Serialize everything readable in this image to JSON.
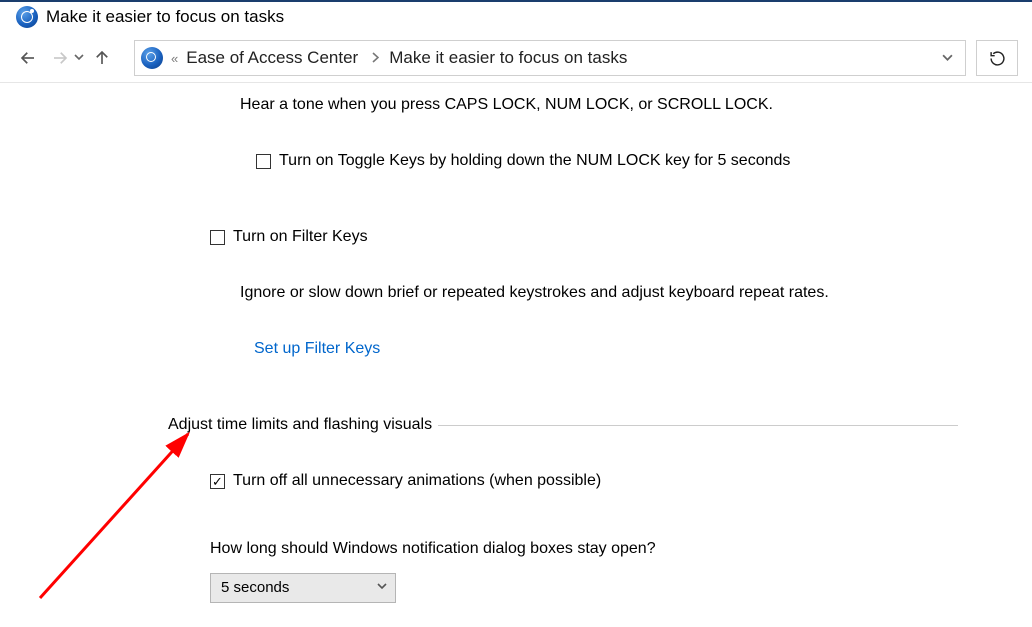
{
  "window": {
    "title": "Make it easier to focus on tasks"
  },
  "breadcrumb": {
    "item1": "Ease of Access Center",
    "item2": "Make it easier to focus on tasks"
  },
  "toggleKeys": {
    "desc": "Hear a tone when you press CAPS LOCK, NUM LOCK, or SCROLL LOCK.",
    "holdLabel": "Turn on Toggle Keys by holding down the NUM LOCK key for 5 seconds"
  },
  "filterKeys": {
    "toggleLabel": "Turn on Filter Keys",
    "desc": "Ignore or slow down brief or repeated keystrokes and adjust keyboard repeat rates.",
    "link": "Set up Filter Keys"
  },
  "timeLimits": {
    "header": "Adjust time limits and flashing visuals",
    "animationsLabel": "Turn off all unnecessary animations (when possible)",
    "durationQuestion": "How long should Windows notification dialog boxes stay open?",
    "durationValue": "5 seconds"
  }
}
